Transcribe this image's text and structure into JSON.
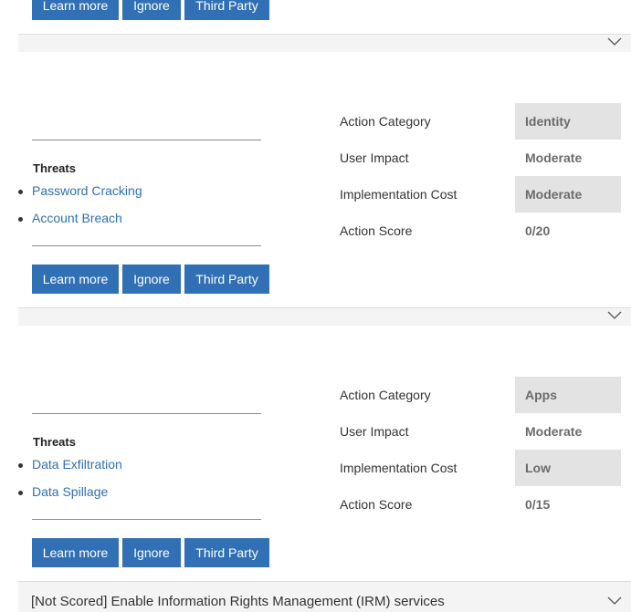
{
  "buttons": {
    "learn_more": "Learn more",
    "ignore": "Ignore",
    "third_party": "Third Party"
  },
  "labels": {
    "threats": "Threats",
    "action_category": "Action Category",
    "user_impact": "User Impact",
    "implementation_cost": "Implementation Cost",
    "action_score": "Action Score"
  },
  "cards": [
    {
      "threats": [
        "Password Cracking",
        "Account Breach"
      ],
      "action_category": "Identity",
      "user_impact": "Moderate",
      "implementation_cost": "Moderate",
      "action_score": "0/20"
    },
    {
      "threats": [
        "Data Exfiltration",
        "Data Spillage"
      ],
      "action_category": "Apps",
      "user_impact": "Moderate",
      "implementation_cost": "Low",
      "action_score": "0/15"
    }
  ],
  "next_item": {
    "title": "[Not Scored] Enable Information Rights Management (IRM) services"
  },
  "icons": {
    "expand": "chevron-down-icon"
  },
  "colors": {
    "button": "#3170b5",
    "link": "#2f6fb3",
    "shade": "#e3e3e3"
  }
}
